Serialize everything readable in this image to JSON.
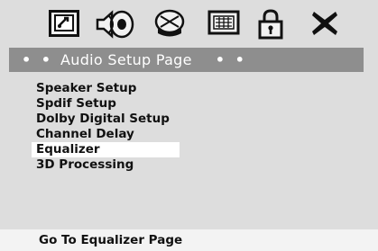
{
  "header": {
    "title": "Audio Setup Page",
    "title_prefix": "• •",
    "title_suffix": "• •"
  },
  "icons": [
    {
      "name": "general-setup-icon"
    },
    {
      "name": "audio-setup-icon"
    },
    {
      "name": "video-setup-icon"
    },
    {
      "name": "preference-icon"
    },
    {
      "name": "password-lock-icon"
    },
    {
      "name": "exit-icon"
    }
  ],
  "menu": {
    "items": [
      {
        "label": "Speaker Setup"
      },
      {
        "label": "Spdif Setup"
      },
      {
        "label": "Dolby Digital Setup"
      },
      {
        "label": "Channel Delay"
      },
      {
        "label": "Equalizer",
        "selected": true
      },
      {
        "label": "3D Processing"
      }
    ]
  },
  "status": {
    "text": "Go To Equalizer Page"
  },
  "colors": {
    "panel": "#dddddd",
    "titlebar": "#8e8e8e",
    "highlight": "#ffffff"
  }
}
